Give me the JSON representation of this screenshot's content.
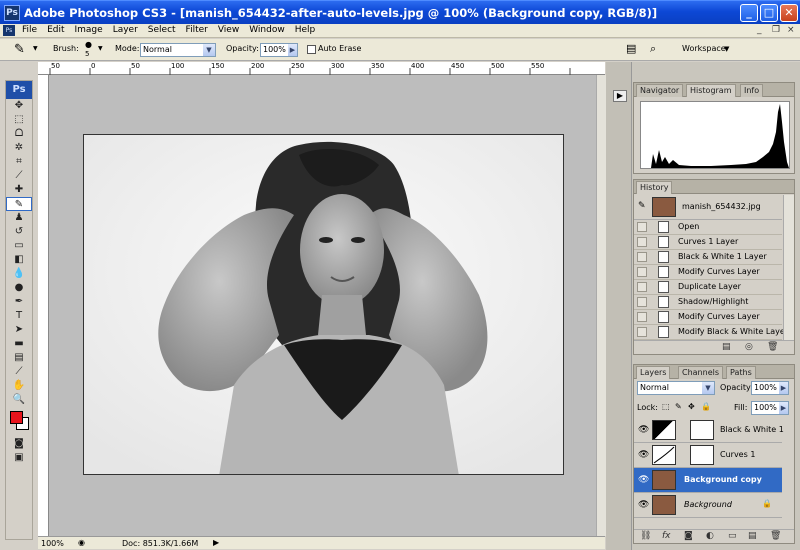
{
  "window": {
    "title": "Adobe Photoshop CS3 - [manish_654432-after-auto-levels.jpg @ 100% (Background copy, RGB/8)]",
    "minimize": "_",
    "maximize": "□",
    "close": "✕"
  },
  "menubar": {
    "logo": "Ps",
    "items": [
      "File",
      "Edit",
      "Image",
      "Layer",
      "Select",
      "Filter",
      "View",
      "Window",
      "Help"
    ],
    "doc_min": "_",
    "doc_restore": "❐",
    "doc_close": "×"
  },
  "options": {
    "brush_label": "Brush:",
    "brush_size": "5",
    "mode_label": "Mode:",
    "mode_value": "Normal",
    "opacity_label": "Opacity:",
    "opacity_value": "100%",
    "auto_erase": "Auto Erase",
    "workspace": "Workspace"
  },
  "toolbox": {
    "logo": "Ps"
  },
  "ruler": {
    "labels": [
      "50",
      "0",
      "50",
      "100",
      "150",
      "200",
      "250",
      "300",
      "350",
      "400",
      "450",
      "500",
      "550"
    ]
  },
  "status": {
    "zoom": "100%",
    "doc": "Doc: 851.3K/1.66M"
  },
  "navigator": {
    "tabs": [
      "Navigator",
      "Histogram",
      "Info"
    ],
    "active": "Histogram"
  },
  "history": {
    "tabs": [
      "History"
    ],
    "snapshot": "manish_654432.jpg",
    "items": [
      "Open",
      "Curves 1 Layer",
      "Black & White 1 Layer",
      "Modify Curves Layer",
      "Duplicate Layer",
      "Shadow/Highlight",
      "Modify Curves Layer",
      "Modify Black & White Layer"
    ]
  },
  "layers": {
    "tabs": [
      "Layers",
      "Channels",
      "Paths"
    ],
    "blend_mode": "Normal",
    "opacity_label": "Opacity:",
    "opacity_value": "100%",
    "lock_label": "Lock:",
    "fill_label": "Fill:",
    "fill_value": "100%",
    "items": [
      "Black & White 1",
      "Curves 1",
      "Background copy",
      "Background"
    ],
    "selected": "Background copy"
  },
  "colors": {
    "accent": "#316ac5",
    "foreground": "#e8141c",
    "background": "#ffffff"
  }
}
